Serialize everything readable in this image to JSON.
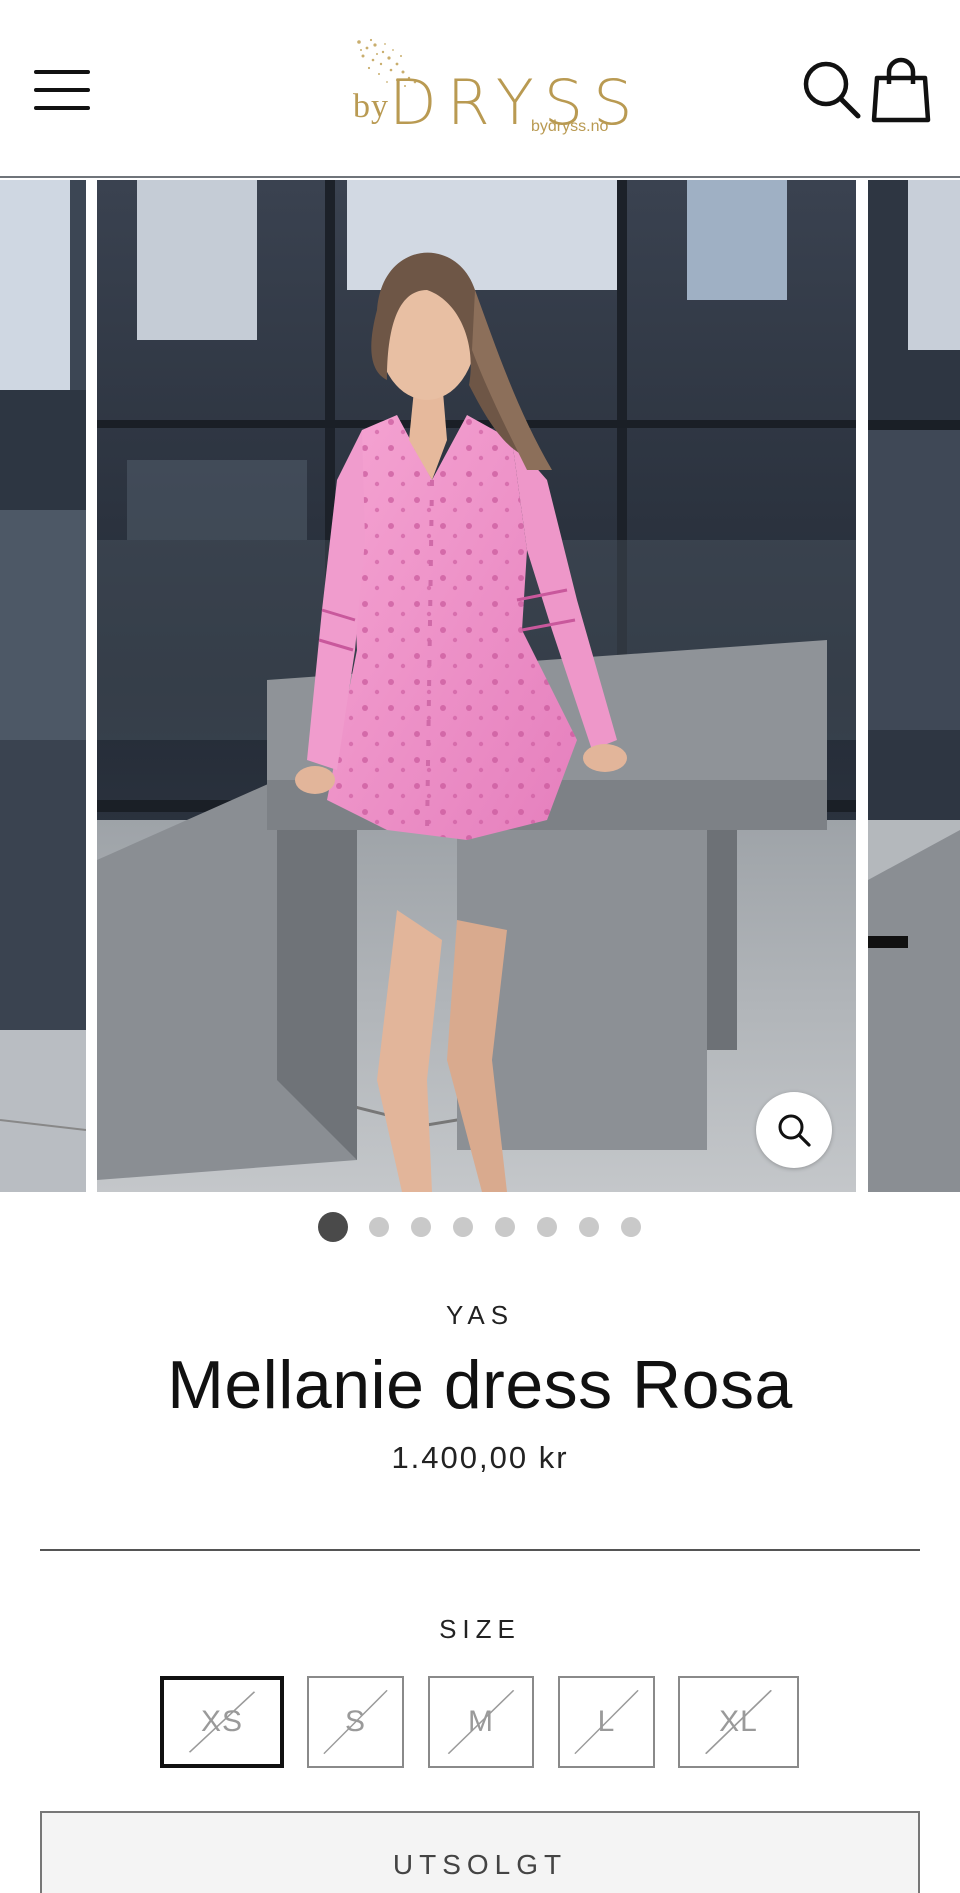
{
  "header": {
    "logo_prefix": "by",
    "logo_brand": "DRYSS",
    "logo_url": "bydryss.no"
  },
  "gallery": {
    "slide_count": 8,
    "active_index": 0
  },
  "product": {
    "vendor": "YAS",
    "title": "Mellanie dress Rosa",
    "price": "1.400,00 kr"
  },
  "size": {
    "label": "SIZE",
    "options": [
      {
        "label": "XS",
        "available": false,
        "selected": true
      },
      {
        "label": "S",
        "available": false,
        "selected": false
      },
      {
        "label": "M",
        "available": false,
        "selected": false
      },
      {
        "label": "L",
        "available": false,
        "selected": false
      },
      {
        "label": "XL",
        "available": false,
        "selected": false
      }
    ]
  },
  "cta": {
    "label": "UTSOLGT"
  },
  "colors": {
    "brand_gold": "#b99a52",
    "dress_pink": "#ef8fc6",
    "text_dark": "#111111"
  }
}
